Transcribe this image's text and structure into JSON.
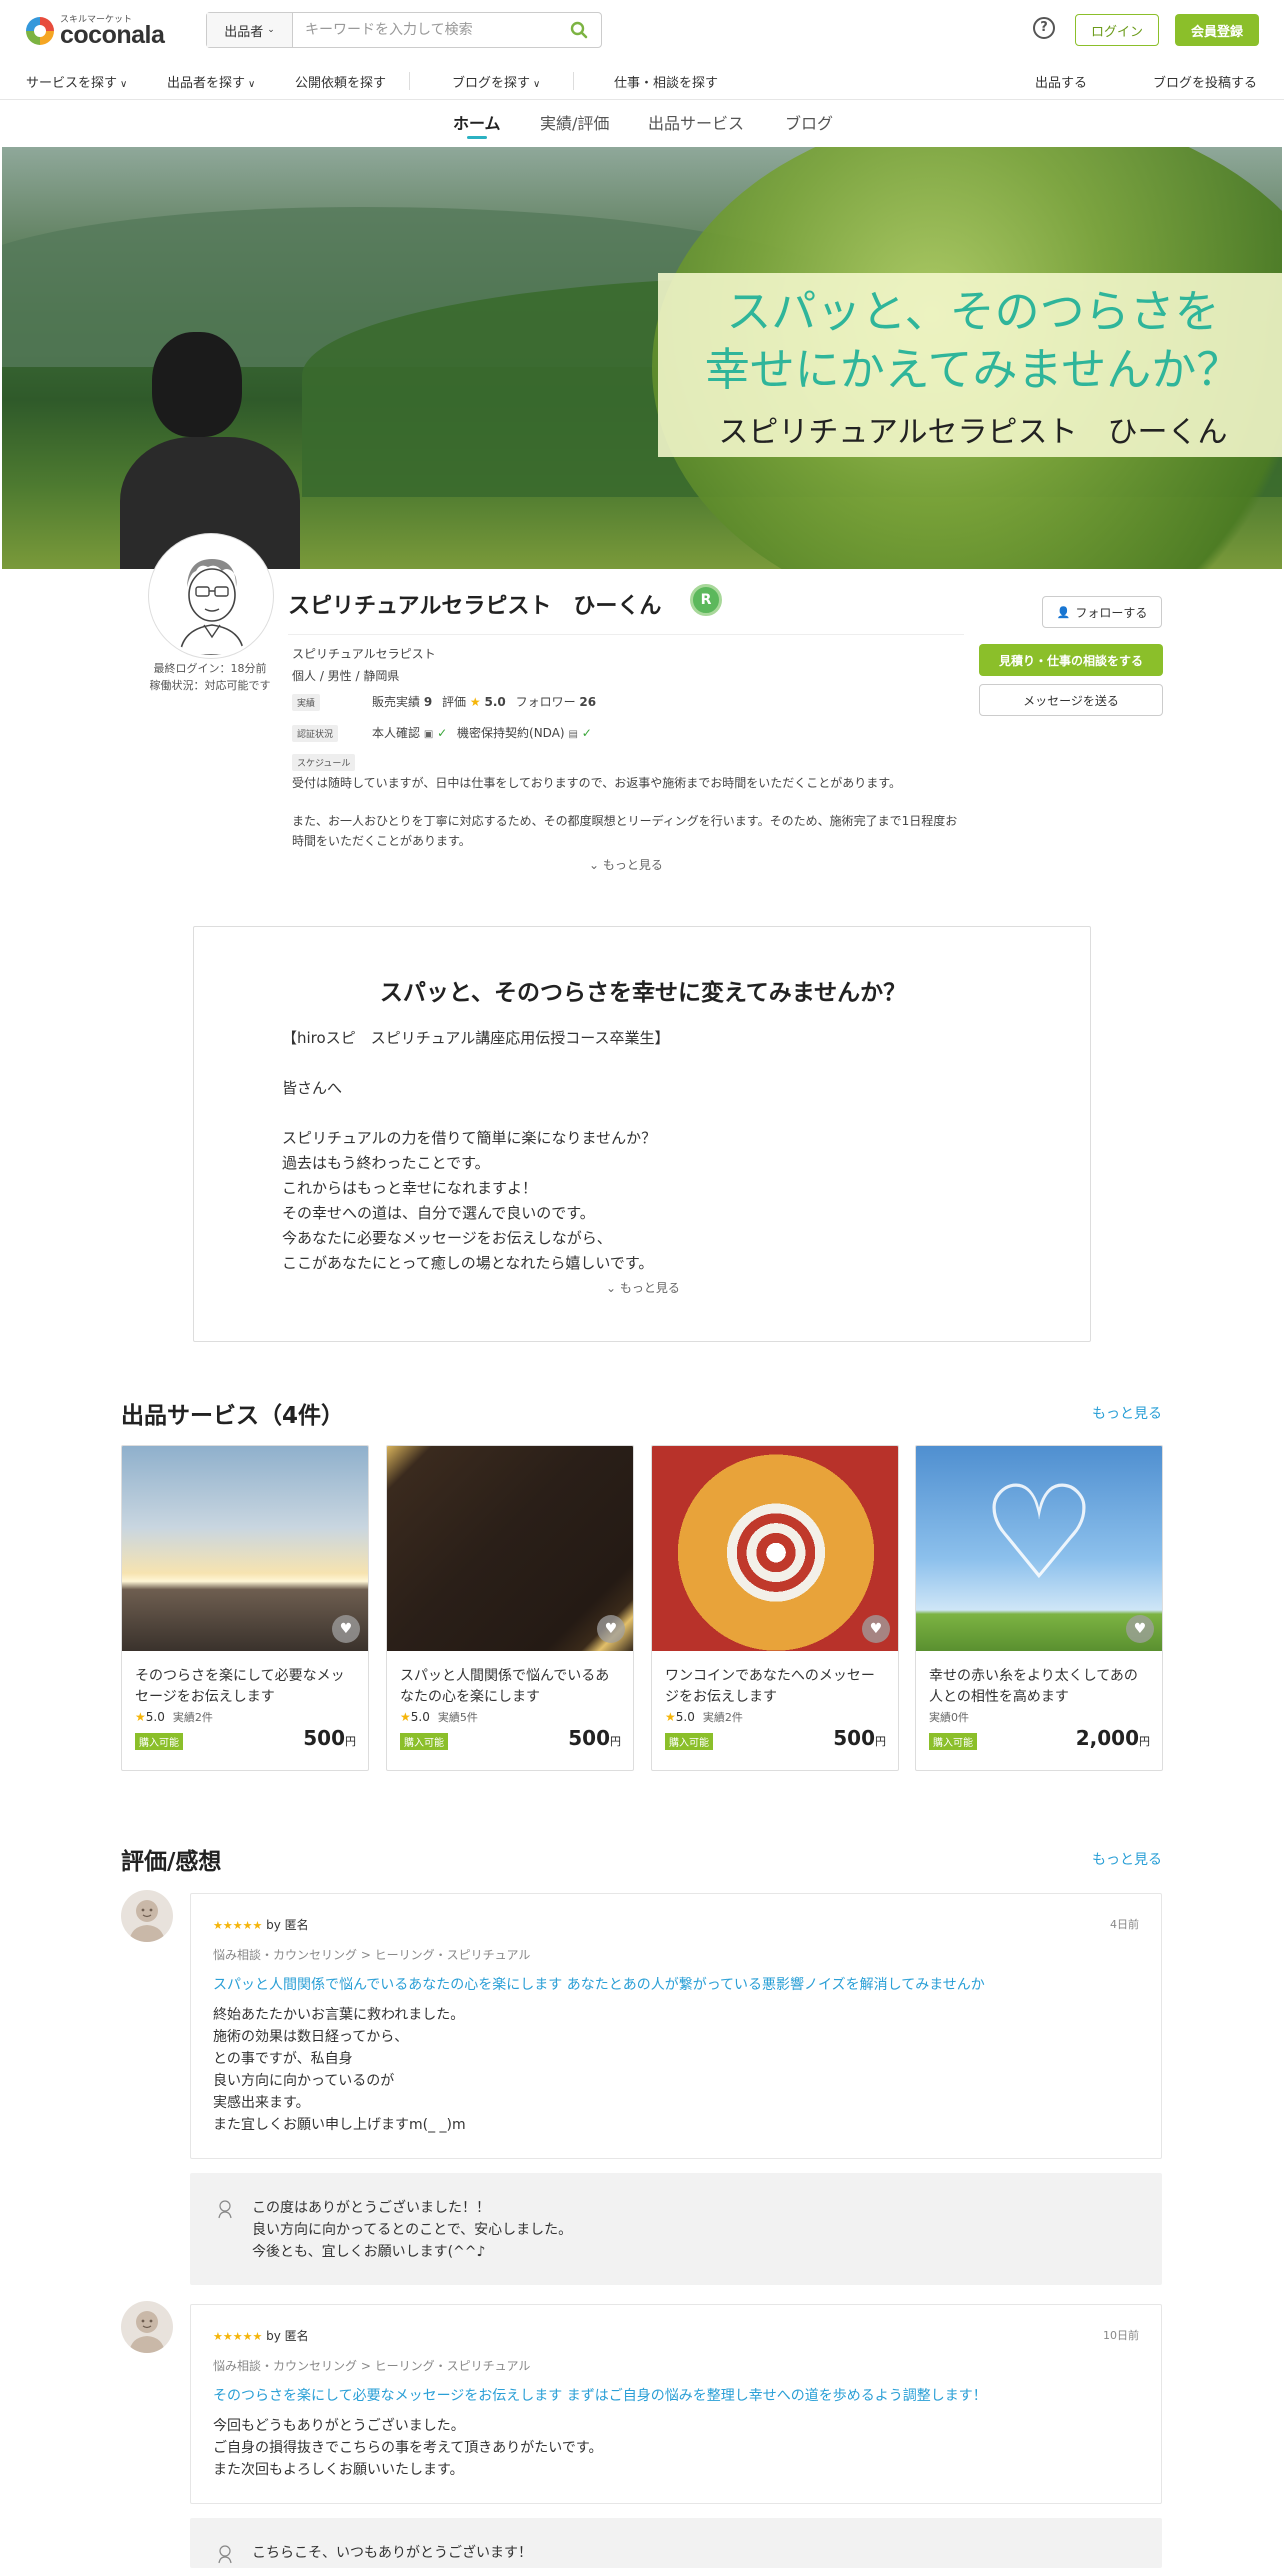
{
  "header": {
    "logo_sub": "スキルマーケット",
    "logo_text": "coconala",
    "search_category": "出品者",
    "search_placeholder": "キーワードを入力して検索",
    "help": "?",
    "login": "ログイン",
    "register": "会員登録"
  },
  "nav": {
    "items": [
      "サービスを探す",
      "出品者を探す",
      "公開依頼を探す",
      "ブログを探す",
      "仕事・相談を探す",
      "出品する",
      "ブログを投稿する"
    ]
  },
  "profile_tabs": [
    "ホーム",
    "実績/評価",
    "出品サービス",
    "ブログ"
  ],
  "hero": {
    "headline_1": "スパッと、そのつらさを",
    "headline_2": "幸せにかえてみませんか？",
    "headline_3": "スピリチュアルセラピスト　ひーくん"
  },
  "profile": {
    "last_login": "最終ログイン：18分前",
    "availability": "稼働状況：対応可能です",
    "name": "スピリチュアルセラピスト　ひーくん",
    "rank": "R",
    "subtitle": "スピリチュアルセラピスト",
    "meta": "個人 / 男性 / 静岡県",
    "record_label": "実績",
    "sales_label": "販売実績",
    "sales_value": "9",
    "rating_label": "評価",
    "rating_value": "5.0",
    "follower_label": "フォロワー",
    "follower_value": "26",
    "cert_label": "認証状況",
    "cert_identity": "本人確認",
    "cert_nda": "機密保持契約(NDA)",
    "schedule_label": "スケジュール",
    "schedule_1": "受付は随時していますが、日中は仕事をしておりますので、お返事や施術までお時間をいただくことがあります。",
    "schedule_2": "また、お一人おひとりを丁寧に対応するため、その都度瞑想とリーディングを行います。そのため、施術完了まで1日程度お",
    "schedule_3": "時間をいただくことがあります。",
    "more": "もっと見る",
    "follow": "フォローする",
    "consult": "見積り・仕事の相談をする",
    "message": "メッセージを送る"
  },
  "intro": {
    "title": "スパッと、そのつらさを幸せに変えてみませんか？",
    "lines": [
      "【hiroスピ　スピリチュアル講座応用伝授コース卒業生】",
      "皆さんへ",
      "スピリチュアルの力を借りて簡単に楽になりませんか？",
      "過去はもう終わったことです。",
      "これからはもっと幸せになれますよ！",
      "その幸せへの道は、自分で選んで良いのです。",
      "今あなたに必要なメッセージをお伝えしながら、",
      "ここがあなたにとって癒しの場となれたら嬉しいです。"
    ],
    "more": "もっと見る"
  },
  "services": {
    "title": "出品サービス（4件）",
    "more": "もっと見る",
    "items": [
      {
        "title": "そのつらさを楽にして必要なメッセージをお伝えします",
        "rating": "5.0",
        "sales": "実績2件",
        "badge": "購入可能",
        "price": "500",
        "unit": "円",
        "colors": [
          "#9fb8cf",
          "#f2d9a0",
          "#5b5048"
        ]
      },
      {
        "title": "スパッと人間関係で悩んでいるあなたの心を楽にします",
        "rating": "5.0",
        "sales": "実績5件",
        "badge": "購入可能",
        "price": "500",
        "unit": "円",
        "colors": [
          "#2a1f18",
          "#c8a24a",
          "#3a2a20"
        ]
      },
      {
        "title": "ワンコインであなたへのメッセージをお伝えします",
        "rating": "5.0",
        "sales": "実績2件",
        "badge": "購入可能",
        "price": "500",
        "unit": "円",
        "colors": [
          "#e8a33a",
          "#f3f0e8",
          "#c0392b"
        ]
      },
      {
        "title": "幸せの赤い糸をより太くしてあの人との相性を高めます",
        "rating": "",
        "sales": "実績0件",
        "badge": "購入可能",
        "price": "2,000",
        "unit": "円",
        "colors": [
          "#5a9bd8",
          "#cfe6f7",
          "#7cb342"
        ]
      }
    ]
  },
  "reviews": {
    "title": "評価/感想",
    "more": "もっと見る",
    "items": [
      {
        "stars": "★★★★★",
        "by": "by 匿名",
        "date": "4日前",
        "category": "悩み相談・カウンセリング > ヒーリング・スピリチュアル",
        "service": "スパッと人間関係で悩んでいるあなたの心を楽にします あなたとあの人が繋がっている悪影響ノイズを解消してみませんか",
        "lines": [
          "終始あたたかいお言葉に救われました。",
          "施術の効果は数日経ってから、",
          "との事ですが、私自身",
          "良い方向に向かっているのが",
          "実感出来ます。",
          "また宜しくお願い申し上げますm(_ _)m"
        ],
        "reply": [
          "この度はありがとうございました！！",
          "良い方向に向かってるとのことで、安心しました。",
          "今後とも、宜しくお願いします(^^♪"
        ]
      },
      {
        "stars": "★★★★★",
        "by": "by 匿名",
        "date": "10日前",
        "category": "悩み相談・カウンセリング > ヒーリング・スピリチュアル",
        "service": "そのつらさを楽にして必要なメッセージをお伝えします まずはご自身の悩みを整理し幸せへの道を歩めるよう調整します！",
        "lines": [
          "今回もどうもありがとうございました。",
          "ご自身の損得抜きでこちらの事を考えて頂きありがたいです。",
          "また次回もよろしくお願いいたします。"
        ],
        "reply": [
          "こちらこそ、いつもありがとうございます！"
        ]
      }
    ]
  },
  "colors": {
    "brand_green": "#8bbf2a",
    "link_blue": "#2a9fd6",
    "tab_accent": "#2bb1c2",
    "hero_text": "#2fb59a"
  }
}
